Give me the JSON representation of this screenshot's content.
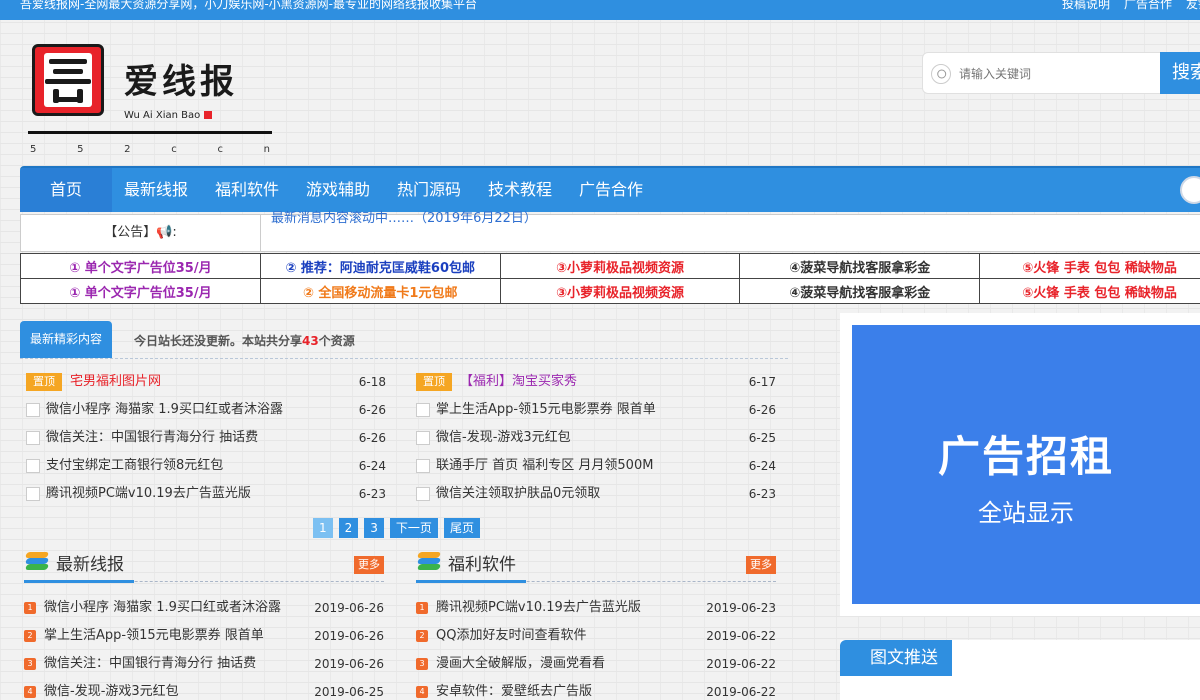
{
  "topbar": {
    "slogan": "吾爱线报网-全网最大资源分享网，小刀娱乐网-小黑资源网-最专业的网络线报收集平台",
    "links": [
      "投稿说明",
      "广告合作",
      "友链"
    ]
  },
  "logo": {
    "name": "爱线报",
    "pinyin": "Wu Ai Xian Bao",
    "domain_chars": [
      "5",
      "5",
      "2",
      "c",
      "",
      "c",
      "n"
    ]
  },
  "search": {
    "placeholder": "请输入关键词",
    "button_label": "搜索"
  },
  "nav": {
    "items": [
      "首页",
      "最新线报",
      "福利软件",
      "游戏辅助",
      "热门源码",
      "技术教程",
      "广告合作"
    ]
  },
  "notice": {
    "label": "【公告】📢:",
    "text": "最新消息内容滚动中……（2019年6月22日）"
  },
  "ads": {
    "rows": [
      [
        {
          "text": "① 单个文字广告位35/月",
          "color": "#9b27b0"
        },
        {
          "text": "② 推荐：阿迪耐克匡威鞋60包邮",
          "color": "#1a3fbf"
        },
        {
          "text": "③小萝莉极品视频资源",
          "color": "#e8232a"
        },
        {
          "text": "④菠菜导航找客服拿彩金",
          "color": "#333333"
        },
        {
          "text": "⑤火锋 手表 包包 稀缺物品",
          "color": "#e8232a"
        }
      ],
      [
        {
          "text": "① 单个文字广告位35/月",
          "color": "#9b27b0"
        },
        {
          "text": "② 全国移动流量卡1元包邮",
          "color": "#f07a1a"
        },
        {
          "text": "③小萝莉极品视频资源",
          "color": "#e8232a"
        },
        {
          "text": "④菠菜导航找客服拿彩金",
          "color": "#333333"
        },
        {
          "text": "⑤火锋 手表 包包 稀缺物品",
          "color": "#e8232a"
        }
      ]
    ]
  },
  "content": {
    "tab_label": "最新精彩内容",
    "notice_prefix": "今日站长还没更新。本站共分享",
    "count": "43",
    "notice_suffix": "个资源",
    "left_list": [
      {
        "pin": "置顶",
        "title": "宅男福利图片网",
        "date": "6-18",
        "title_color": "#e8232a"
      },
      {
        "title": "微信小程序 海猫家 1.9买口红或者沐浴露",
        "date": "6-26"
      },
      {
        "title": "微信关注：中国银行青海分行 抽话费",
        "date": "6-26"
      },
      {
        "title": "支付宝绑定工商银行领8元红包",
        "date": "6-24"
      },
      {
        "title": "腾讯视频PC端v10.19去广告蓝光版",
        "date": "6-23"
      }
    ],
    "right_list": [
      {
        "pin": "置顶",
        "title": "【福利】淘宝买家秀",
        "date": "6-17",
        "title_color": "#9b27b0"
      },
      {
        "title": "掌上生活App-领15元电影票券 限首单",
        "date": "6-26"
      },
      {
        "title": "微信-发现-游戏3元红包",
        "date": "6-25"
      },
      {
        "title": "联通手厅 首页 福利专区 月月领500M",
        "date": "6-24"
      },
      {
        "title": "微信关注领取护肤品0元领取",
        "date": "6-23"
      }
    ],
    "pager": [
      "1",
      "2",
      "3",
      "下一页",
      "尾页"
    ]
  },
  "sections": [
    {
      "title": "最新线报",
      "more": "更多",
      "items": [
        {
          "num": "1",
          "title": "微信小程序 海猫家 1.9买口红或者沐浴露",
          "date": "2019-06-26"
        },
        {
          "num": "2",
          "title": "掌上生活App-领15元电影票券 限首单",
          "date": "2019-06-26"
        },
        {
          "num": "3",
          "title": "微信关注：中国银行青海分行 抽话费",
          "date": "2019-06-26"
        },
        {
          "num": "4",
          "title": "微信-发现-游戏3元红包",
          "date": "2019-06-25"
        }
      ]
    },
    {
      "title": "福利软件",
      "more": "更多",
      "items": [
        {
          "num": "1",
          "title": "腾讯视频PC端v10.19去广告蓝光版",
          "date": "2019-06-23"
        },
        {
          "num": "2",
          "title": "QQ添加好友时间查看软件",
          "date": "2019-06-22"
        },
        {
          "num": "3",
          "title": "漫画大全破解版，漫画党看看",
          "date": "2019-06-22"
        },
        {
          "num": "4",
          "title": "安卓软件：爱壁纸去广告版",
          "date": "2019-06-22"
        }
      ]
    }
  ],
  "adbanner": {
    "title": "广告招租",
    "subtitle": "全站显示"
  },
  "picnews": {
    "title": "图文推送"
  },
  "colors": {
    "brand_blue": "#2f8fe0",
    "accent_orange": "#f06a2c",
    "pin_orange": "#f5a623",
    "logo_red": "#e8232a"
  }
}
